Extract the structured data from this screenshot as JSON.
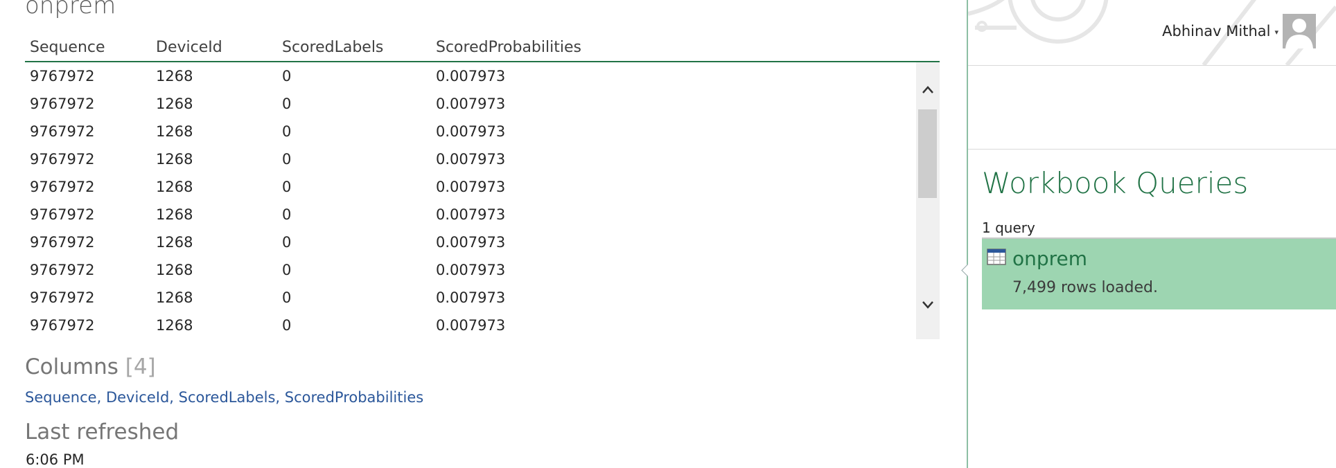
{
  "preview": {
    "title": "onprem",
    "columns": [
      "Sequence",
      "DeviceId",
      "ScoredLabels",
      "ScoredProbabilities"
    ],
    "rows": [
      [
        "9767972",
        "1268",
        "0",
        "0.007973"
      ],
      [
        "9767972",
        "1268",
        "0",
        "0.007973"
      ],
      [
        "9767972",
        "1268",
        "0",
        "0.007973"
      ],
      [
        "9767972",
        "1268",
        "0",
        "0.007973"
      ],
      [
        "9767972",
        "1268",
        "0",
        "0.007973"
      ],
      [
        "9767972",
        "1268",
        "0",
        "0.007973"
      ],
      [
        "9767972",
        "1268",
        "0",
        "0.007973"
      ],
      [
        "9767972",
        "1268",
        "0",
        "0.007973"
      ],
      [
        "9767972",
        "1268",
        "0",
        "0.007973"
      ],
      [
        "9767972",
        "1268",
        "0",
        "0.007973"
      ]
    ],
    "columns_heading": "Columns",
    "columns_count": "[4]",
    "column_links": [
      "Sequence",
      "DeviceId",
      "ScoredLabels",
      "ScoredProbabilities"
    ],
    "last_refreshed_heading": "Last refreshed",
    "last_refreshed_time": "6:06 PM"
  },
  "header": {
    "user_name": "Abhinav Mithal",
    "user_caret": "▾"
  },
  "pane": {
    "title": "Workbook Queries",
    "count": "1 query",
    "queries": [
      {
        "name": "onprem",
        "status": "7,499 rows loaded.",
        "icon": "table-icon"
      }
    ]
  },
  "scrollbar": {
    "up": "⌃",
    "down": "⌄"
  },
  "colors": {
    "accent": "#217346",
    "selected_card": "#9dd5b1",
    "link": "#2b579a"
  }
}
